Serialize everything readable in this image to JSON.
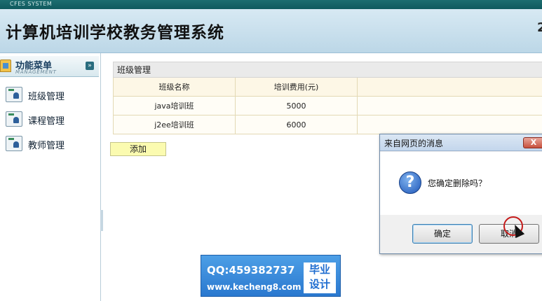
{
  "topbar": {
    "label": "CFES SYSTEM"
  },
  "header": {
    "title": "计算机培训学校教务管理系统",
    "edge_fragment": "2"
  },
  "sidebar": {
    "title": "功能菜单",
    "subtitle": "MANAGEMENT",
    "toggle_icon": "double-chevron-down-icon",
    "items": [
      {
        "label": "班级管理",
        "icon": "class-manage-icon"
      },
      {
        "label": "课程管理",
        "icon": "course-manage-icon"
      },
      {
        "label": "教师管理",
        "icon": "teacher-manage-icon"
      }
    ]
  },
  "panel": {
    "caption": "班级管理",
    "columns": [
      "班级名称",
      "培训费用(元)"
    ],
    "rows": [
      {
        "name": "java培训班",
        "fee": "5000"
      },
      {
        "name": "j2ee培训班",
        "fee": "6000"
      }
    ],
    "add_label": "添加"
  },
  "dialog": {
    "title": "来自网页的消息",
    "close_label": "X",
    "message": "您确定删除吗？",
    "ok_label": "确定",
    "cancel_label": "取消"
  },
  "watermark": {
    "qq": "QQ:459382737",
    "url": "www.kecheng8.com",
    "badge_line1": "毕业",
    "badge_line2": "设计"
  }
}
